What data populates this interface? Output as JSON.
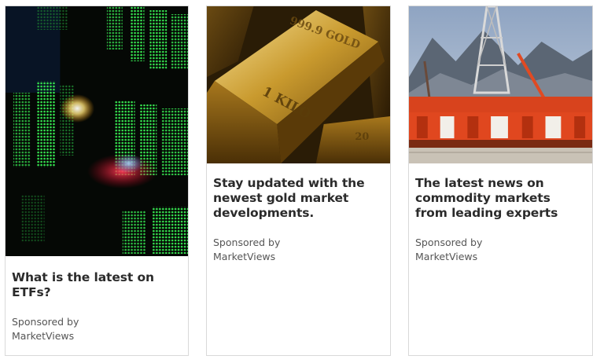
{
  "cards": [
    {
      "headline": "What is the latest on ETFs?",
      "sponsor_line1": "Sponsored by",
      "sponsor_line2": "MarketViews",
      "image": "stock-ticker-board-image"
    },
    {
      "headline": "Stay updated with the newest gold market developments.",
      "sponsor_line1": "Sponsored by",
      "sponsor_line2": "MarketViews",
      "image": "gold-bars-image",
      "image_text": {
        "bar_top": "999.9 GOLD",
        "bar_main": "1 KILO",
        "bar_corner": "20"
      }
    },
    {
      "headline": "The latest news on commodity markets from leading experts",
      "sponsor_line1": "Sponsored by",
      "sponsor_line2": "MarketViews",
      "image": "offshore-oil-rig-image"
    }
  ],
  "colors": {
    "headline": "#2b2b2b",
    "sponsor": "#555555",
    "border": "#d9d9d9",
    "ticker_green": "#2bd94a",
    "gold": "#c9a227",
    "rig_orange": "#e0471f"
  }
}
